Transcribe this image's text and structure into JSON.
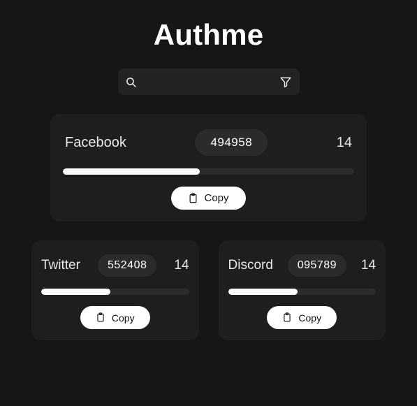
{
  "app": {
    "title": "Authme",
    "background_color": "#161616",
    "card_color": "#1e1e1e",
    "pill_color": "#2b2b2b",
    "accent_color": "#ffffff"
  },
  "search": {
    "value": "",
    "placeholder": "",
    "search_icon": "search-icon",
    "filter_icon": "filter-funnel-icon"
  },
  "entries": [
    {
      "name": "Facebook",
      "code": "494958",
      "counter": "14",
      "progress_percent": 47,
      "copy_label": "Copy",
      "copy_icon": "clipboard-icon"
    },
    {
      "name": "Twitter",
      "code": "552408",
      "counter": "14",
      "progress_percent": 47,
      "copy_label": "Copy",
      "copy_icon": "clipboard-icon"
    },
    {
      "name": "Discord",
      "code": "095789",
      "counter": "14",
      "progress_percent": 47,
      "copy_label": "Copy",
      "copy_icon": "clipboard-icon"
    }
  ]
}
